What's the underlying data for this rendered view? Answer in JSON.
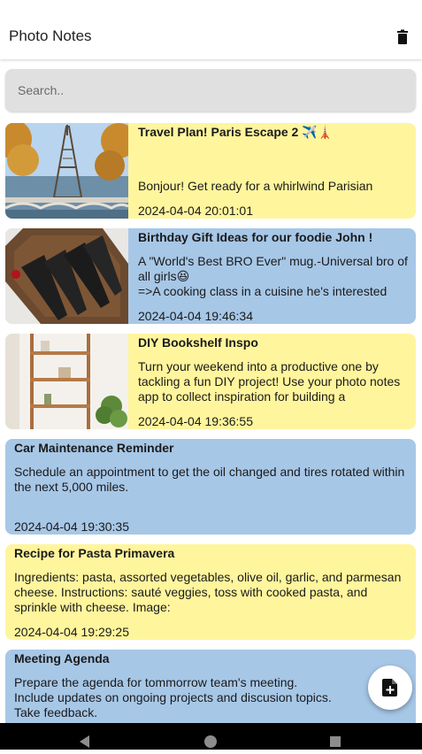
{
  "app": {
    "title": "Photo Notes"
  },
  "toolbar": {
    "delete_icon": "trash-icon"
  },
  "search": {
    "placeholder": "Search.."
  },
  "notes": [
    {
      "title": "Travel Plan! Paris Escape 2 ✈️🗼",
      "text": "Bonjour! Get ready for a whirlwind Parisian",
      "date": "2024-04-04 20:01:01",
      "color": "#fff59d",
      "image": "eiffel-tower-photo"
    },
    {
      "title": "Birthday Gift Ideas for our foodie  John !",
      "text": "A \"World's Best BRO Ever\" mug.-Universal bro of all girls😆\n=>A cooking class in a cuisine he's interested",
      "date": "2024-04-04 19:46:34",
      "color": "#a7c7e7",
      "image": "kitchen-knives-photo"
    },
    {
      "title": "DIY Bookshelf Inspo",
      "text": "Turn your weekend into a productive one by tackling a fun DIY project! Use your photo notes app to collect inspiration for building a",
      "date": "2024-04-04 19:36:55",
      "color": "#fff59d",
      "image": "bookshelf-photo"
    },
    {
      "title": "Car Maintenance Reminder",
      "text": "Schedule an appointment to get the oil changed and tires rotated within the next 5,000 miles.",
      "date": "2024-04-04 19:30:35",
      "color": "#a7c7e7"
    },
    {
      "title": "Recipe for Pasta Primavera",
      "text": "Ingredients: pasta, assorted vegetables, olive oil, garlic, and parmesan cheese. Instructions: sauté veggies, toss with cooked pasta, and sprinkle with cheese. Image:",
      "date": "2024-04-04 19:29:25",
      "color": "#fff59d"
    },
    {
      "title": "Meeting Agenda",
      "text": "Prepare the agenda for tommorrow team's meeting.\nInclude updates on ongoing projects and discusion topics.\nTake feedback.",
      "color": "#a7c7e7"
    }
  ],
  "fab": {
    "icon": "add-note-icon"
  },
  "system_nav": {
    "back": "back-icon",
    "home": "home-icon",
    "recents": "recents-icon"
  }
}
